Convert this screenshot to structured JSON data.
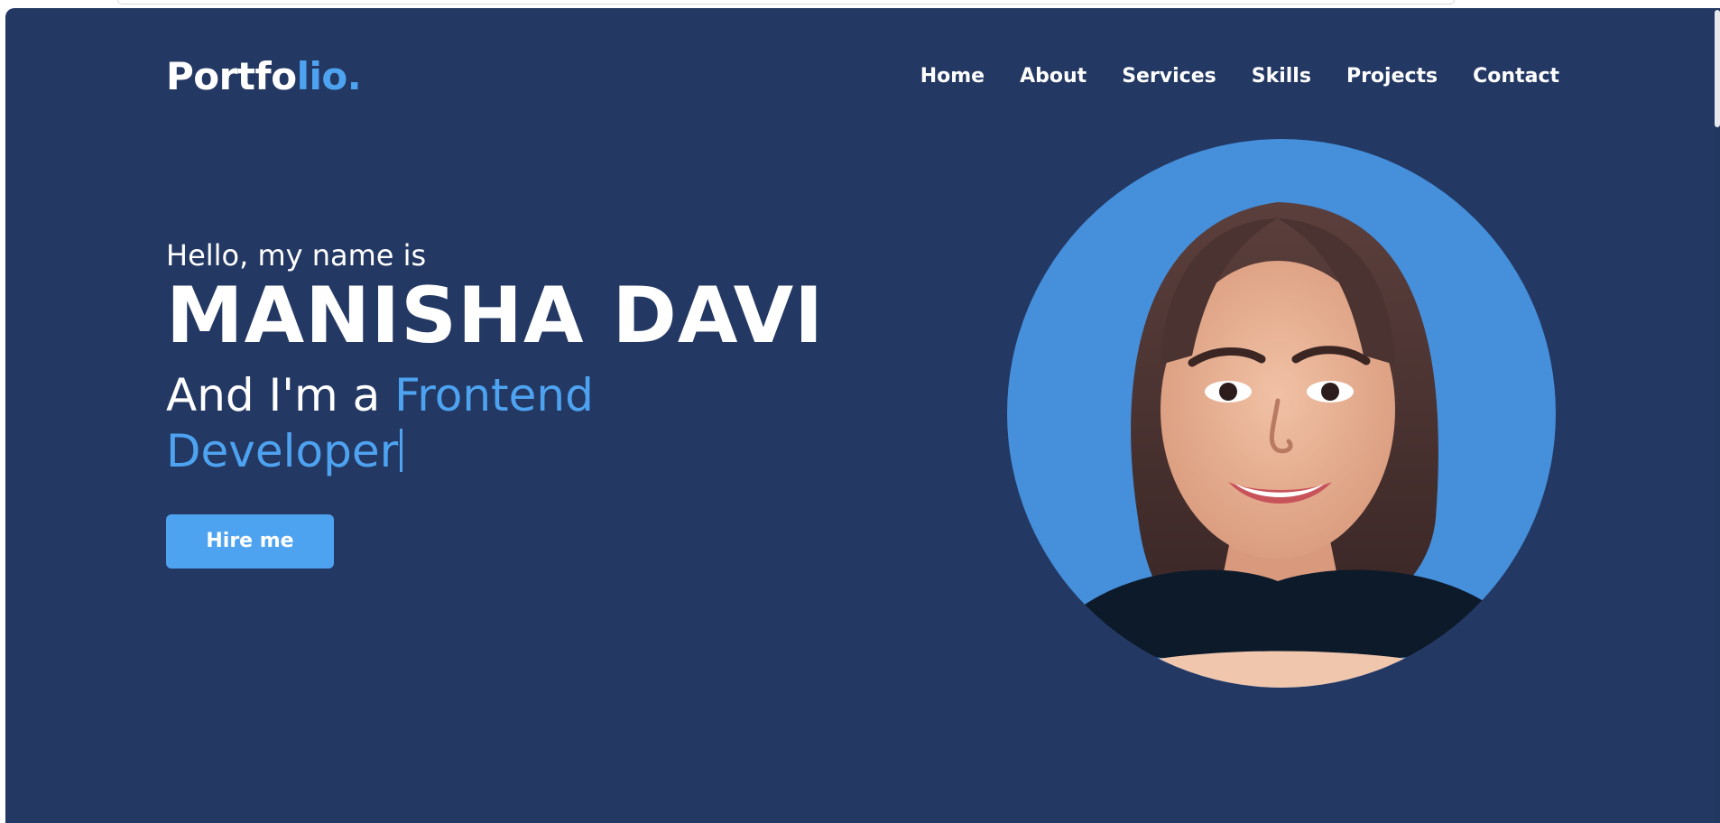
{
  "logo": {
    "main": "Portfo",
    "accent": "lio."
  },
  "nav": {
    "items": [
      {
        "label": "Home"
      },
      {
        "label": "About"
      },
      {
        "label": "Services"
      },
      {
        "label": "Skills"
      },
      {
        "label": "Projects"
      },
      {
        "label": "Contact"
      }
    ]
  },
  "hero": {
    "greeting": "Hello, my name is",
    "name": "MANISHA DAVI",
    "role_prefix": "And I'm a ",
    "role": "Frontend Developer",
    "button": "Hire me"
  },
  "colors": {
    "background": "#233863",
    "accent": "#4ea3f1",
    "profile_bg": "#458fdb"
  },
  "icons": {
    "profile": "profile-photo"
  }
}
